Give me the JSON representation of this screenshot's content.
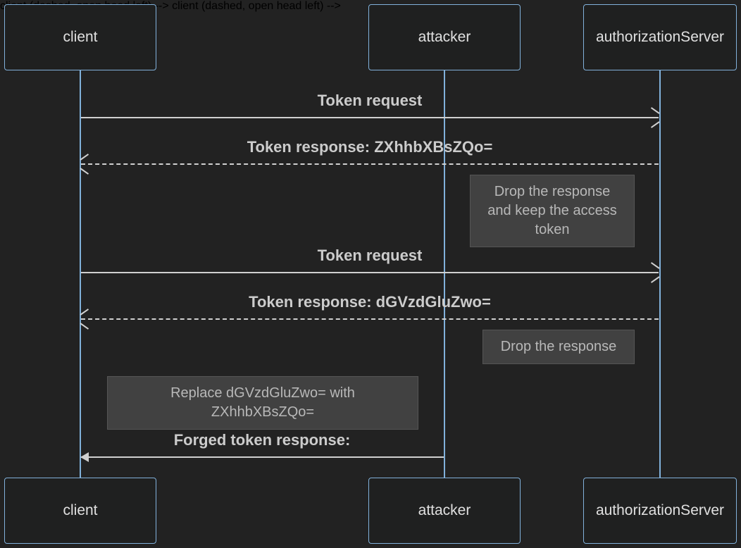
{
  "actors": {
    "client": "client",
    "attacker": "attacker",
    "authServer": "authorizationServer"
  },
  "messages": {
    "m1": "Token request",
    "m2": "Token response: ZXhhbXBsZQo=",
    "m3": "Token request",
    "m4": "Token response: dGVzdGluZwo=",
    "m5": "Forged token response:"
  },
  "notes": {
    "n1": "Drop the response and keep the access token",
    "n2": "Drop the response",
    "n3": "Replace dGVzdGluZwo= with ZXhhbXBsZQo="
  },
  "layout": {
    "clientX": 114,
    "attackerX": 631,
    "authX": 937,
    "topActorY": 6,
    "bottomActorY": 678,
    "lifelineTop": 100,
    "lifelineBottom": 678
  }
}
